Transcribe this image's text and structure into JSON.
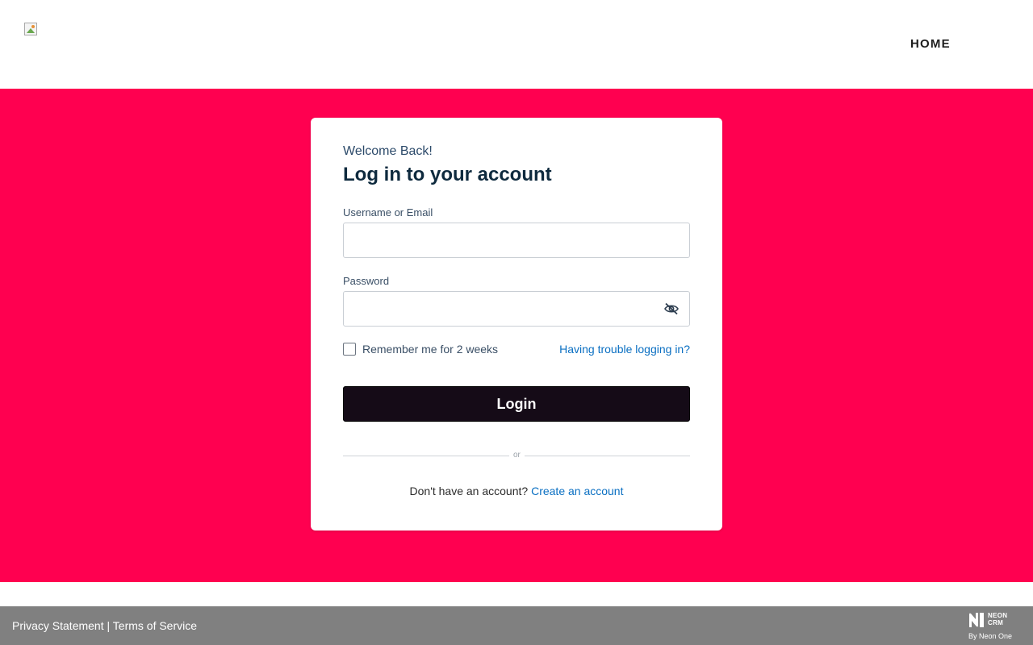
{
  "header": {
    "logo_icon": "broken-image-icon",
    "nav": {
      "home_label": "HOME"
    }
  },
  "colors": {
    "hero_background": "#ff0050",
    "login_button": "#150b17",
    "link": "#0a6fc2",
    "footer_background": "#808080"
  },
  "login_card": {
    "welcome": "Welcome Back!",
    "title": "Log in to your account",
    "username": {
      "label": "Username or Email",
      "value": "",
      "placeholder": ""
    },
    "password": {
      "label": "Password",
      "value": "",
      "placeholder": "",
      "toggle_icon": "eye-slash-icon"
    },
    "remember_label": "Remember me for 2 weeks",
    "remember_checked": false,
    "trouble_link": "Having trouble logging in?",
    "login_button": "Login",
    "divider_text": "or",
    "signup_prompt": "Don't have an account?",
    "signup_link": "Create an account"
  },
  "footer": {
    "privacy_link": "Privacy Statement",
    "separator": "|",
    "terms_link": "Terms of Service",
    "brand": {
      "icon": "neon-logo-icon",
      "line1": "NEON",
      "line2": "CRM",
      "by": "By Neon One"
    }
  }
}
